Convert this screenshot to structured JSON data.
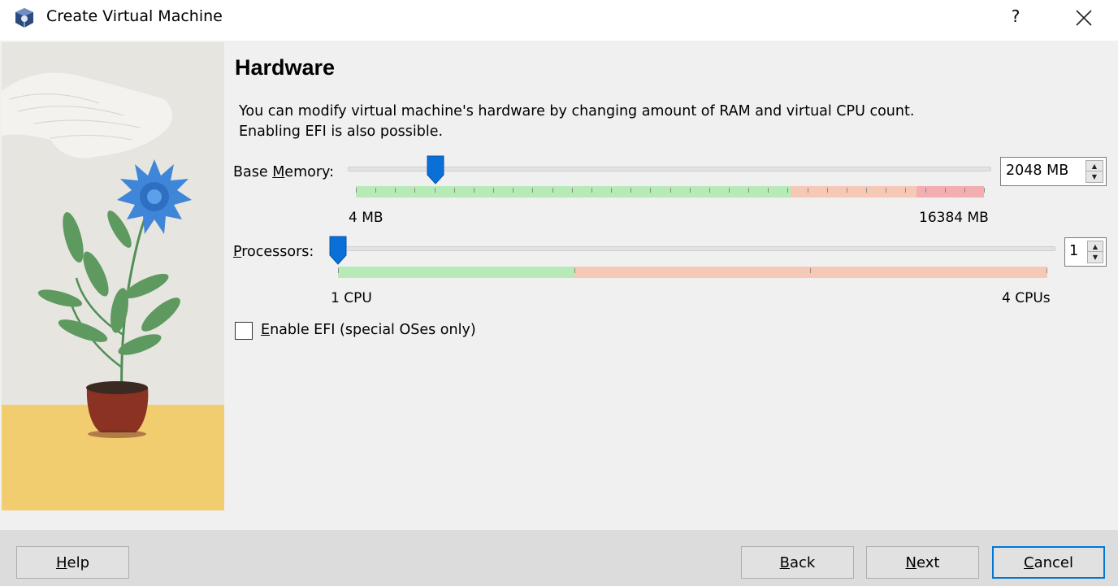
{
  "window": {
    "title": "Create Virtual Machine",
    "help_glyph": "?",
    "icon": "virtualbox-icon",
    "close_icon": "close-icon"
  },
  "page": {
    "heading": "Hardware",
    "description_line1": "You can modify virtual machine's hardware by changing amount of RAM and virtual CPU count.",
    "description_line2": "Enabling EFI is also possible."
  },
  "memory": {
    "label_pre": "Base ",
    "label_mnemonic": "M",
    "label_post": "emory:",
    "value": "2048 MB",
    "value_mb": 2048,
    "min_label": "4 MB",
    "max_label": "16384 MB"
  },
  "processors": {
    "label_mnemonic": "P",
    "label_post": "rocessors:",
    "value": "1",
    "min_label": "1 CPU",
    "max_label": "4 CPUs"
  },
  "efi": {
    "label_mnemonic": "E",
    "label_post": "nable EFI (special OSes only)",
    "checked": false
  },
  "buttons": {
    "help_mnemonic": "H",
    "help_rest": "elp",
    "back_mnemonic": "B",
    "back_rest": "ack",
    "next_mnemonic": "N",
    "next_rest": "ext",
    "cancel_mnemonic": "C",
    "cancel_rest": "ancel"
  },
  "colors": {
    "scale_green": "#b7eab7",
    "scale_orange": "#f6c8b6",
    "scale_red": "#f2aeb0",
    "slider_thumb": "#0a6fd6",
    "default_button_border": "#0078d7"
  }
}
